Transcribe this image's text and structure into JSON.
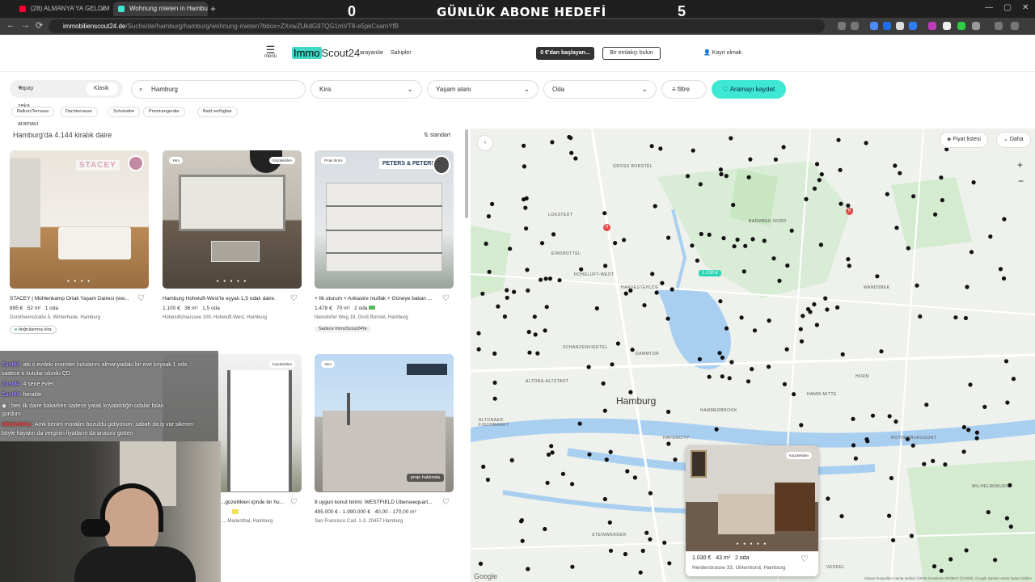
{
  "browser": {
    "tabs": [
      {
        "label": "(28) ALMANYA'YA GELDİM: BEN",
        "close": "×"
      },
      {
        "label": "Wohnung mieten in Hamburg",
        "close": "×"
      }
    ],
    "new_tab": "+",
    "url_domain": "immobilienscout24.de",
    "url_path": "/Suche/de/hamburg/hamburg/wohnung-mieten?bbox=ZXxwZUkdG97QG1mVT8-e5pkCsamYfB",
    "nav_back": "←",
    "nav_forward": "→",
    "nav_reload": "⟳",
    "win_min": "—",
    "win_max": "▢",
    "win_close": "✕",
    "accent": "#3ee8d3"
  },
  "stream_overlay": {
    "left_count": "0",
    "goal_text": "GÜNLÜK ABONE HEDEFİ",
    "right_count": "5"
  },
  "site": {
    "menu_icon": "☰",
    "menu_label": "menü",
    "logo_immo": "Immo",
    "logo_scout": "Scout24",
    "link_seekers": "arayanlar",
    "link_owners": "Sahipler",
    "btn_start": "0 €'dan başlayan...",
    "btn_agent": "Bir emlakçı bulun",
    "register_icon": "👤",
    "register": "Kayıt olmak"
  },
  "filters": {
    "ai_search": "Yapay zeka araması",
    "classic": "Klasik",
    "location": "Hamburg",
    "rent": "Kira",
    "living_area": "Yaşam alanı",
    "rooms": "Oda",
    "filter": "filtre",
    "save_search": "Aramayı kaydet",
    "chevron": "⌄",
    "chips": [
      "Balkon/Terrasse",
      "Dachterrasse",
      "Schulnähe",
      "Premiumgeräte",
      "Bald verfügbar"
    ]
  },
  "results": {
    "count": "Hamburg'da 4.144 kiralık daire",
    "sort": "standart"
  },
  "listings": [
    {
      "title": "STACEY | Mühlenkamp Ortak Yaşam Dairesi (ww...",
      "price": "895 €",
      "area": "52 m²",
      "rooms": "1 oda",
      "address": "Dorotheenstraße 5, Winterhude, Hamburg",
      "tag": "doğrulanmış kira",
      "brand": "STACEY",
      "badge": ""
    },
    {
      "title": "Hamburg Hoheluft-West'te eşyalı 1,5 odalı daire.",
      "price": "1.100 €",
      "area": "36 m²",
      "rooms": "1,5 oda",
      "address": "Hoheluftchaussee 109, Hoheluft-West, Hamburg",
      "tag": "",
      "brand": "",
      "badge_left": "Yeni",
      "badge": "küçükeliden"
    },
    {
      "title": "+ İlk oturum + Ankastre mutfak + Güneye bakan ...",
      "price": "1.478 €",
      "area": "70 m²",
      "rooms": "2 oda",
      "address": "Niendorfer Weg 19, Groß Borstel, Hamburg",
      "tag": "Sadece ImmoScout24'te",
      "brand": "PETERS & PETERS",
      "badge_left": "Proje birimi",
      "badge": ""
    },
    {
      "title": "...güzellikleri içinde bir hu...",
      "price": "",
      "area": "",
      "rooms": "",
      "address": "..., Marienthal, Hamburg",
      "tag": "",
      "brand": "",
      "badge": "küçükeliden"
    },
    {
      "title": "8 uygun konut birimi: WESTFIELD Überseequart...",
      "price": "495.000 € - 1.990.000 €",
      "area": "40,00 - 170,00 m²",
      "rooms": "",
      "address": "San Francisco Cad. 1-3, 20457 Hamburg",
      "tag": "",
      "brand": "",
      "badge_left": "Yeni",
      "project": "proje hakkında"
    }
  ],
  "chat": [
    {
      "user": "Zuet84",
      "text": ": abi o evdeki monster kutularını almanyadaki bir eve koysak 1 oda"
    },
    {
      "user": "",
      "text": "sadece o kutular olurdu ÇD"
    },
    {
      "user": "Zuet84",
      "text": ": 4 sene evler"
    },
    {
      "user": "Zuet84",
      "text": ": heralde"
    },
    {
      "user": "",
      "text": ": ben ilk daire bakarken sadece yatak koyabildiğin odalar falan"
    },
    {
      "user": "",
      "text": "gordum"
    },
    {
      "user": "kibbleMALI",
      "text": ": Amk benim moralim bozuldu gidiyorum, sabah da iş var sikerim"
    },
    {
      "user": "",
      "text": "böyle hayatın da verginin fiyatların da anasını gotten"
    }
  ],
  "map": {
    "price_list": "Fiyat listesi",
    "more": "Daha",
    "zoom_in": "+",
    "zoom_out": "−",
    "back": "‹",
    "price_pin": "1.030 €",
    "city": "Hamburg",
    "districts": [
      "GROSS BORSTEL",
      "LOKSTEDT",
      "BARMBEK-NORD",
      "EIMSBÜTTEL",
      "HOHELUFT-WEST",
      "HARVESTEHUDE",
      "WANDSBEK",
      "SCHANZENVIERTEL",
      "DAMMTOR",
      "ALTONA-ALTSTADT",
      "HAMMERBROOK",
      "HAFENCITY",
      "ALTONAER FISCHMARKT",
      "HORN",
      "HAMM-MITTE",
      "STEINWERDER",
      "VEDDEL",
      "WILHELMSBURG",
      "ROTHENBURGSORT"
    ],
    "popup": {
      "price": "1.030 €",
      "area": "43 m²",
      "rooms": "2 oda",
      "address": "Herderstrasse 33, Uhlenhorst, Hamburg",
      "badge": "küçükeliden"
    },
    "google": "Google",
    "attribution": "Klavye kısayolları   Harita verileri ©2026 GeoBasis-DE/BKG (©2009), Google   Şartlar   Harita hatası bildirin"
  }
}
